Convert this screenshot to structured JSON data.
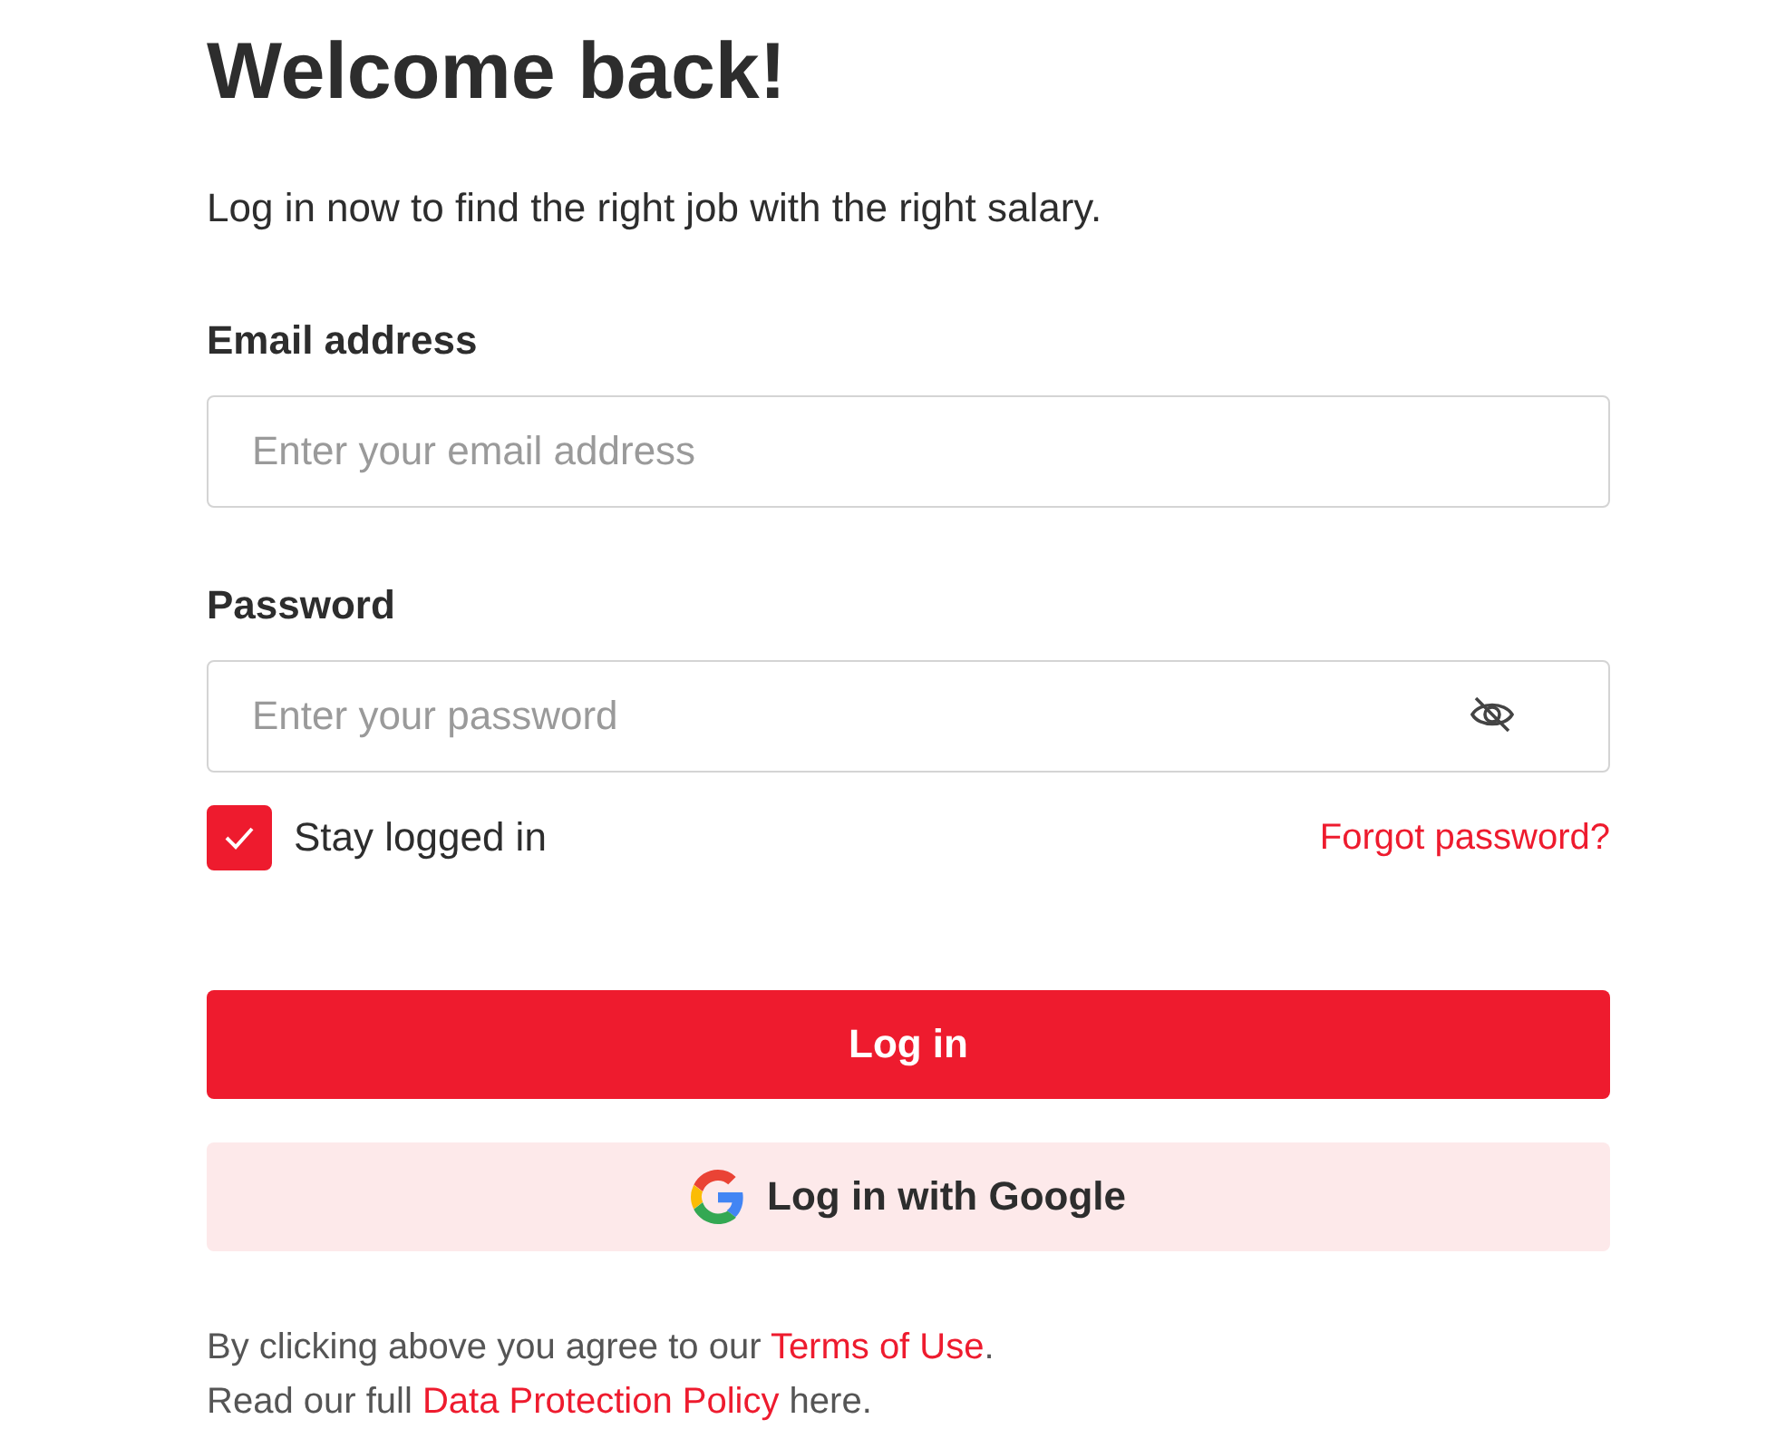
{
  "title": "Welcome back!",
  "subtitle": "Log in now to find the right job with the right salary.",
  "fields": [
    {
      "label": "Email address",
      "placeholder": "Enter your email address",
      "kind": "text"
    },
    {
      "label": "Password",
      "placeholder": "Enter your password",
      "kind": "password"
    }
  ],
  "stay_logged_in": {
    "label": "Stay logged in",
    "checked": true
  },
  "forgot_link": "Forgot password?",
  "login_button": "Log in",
  "google_button": "Log in with Google",
  "footer": [
    {
      "before": "By clicking above you agree to our ",
      "link": "Terms of Use",
      "after": "."
    },
    {
      "before": "Read our full ",
      "link": "Data Protection Policy",
      "after": " here."
    }
  ]
}
